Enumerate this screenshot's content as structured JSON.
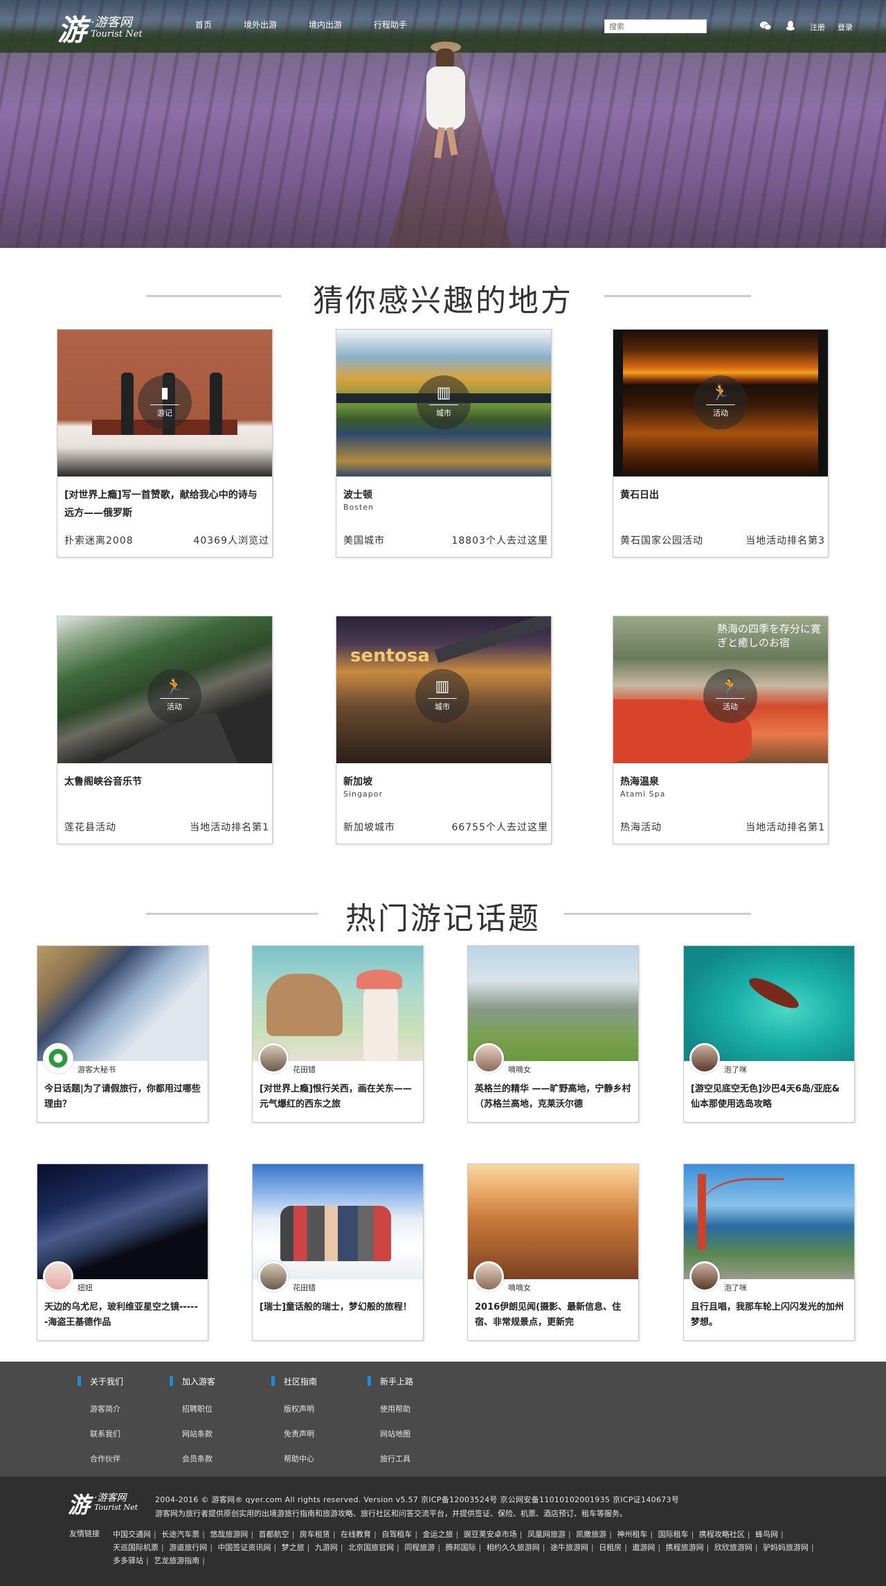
{
  "header": {
    "logo_mark": "游",
    "logo_cn": "·游客网",
    "logo_en": "Tourist Net",
    "nav": [
      "首页",
      "境外出游",
      "境内出游",
      "行程助手"
    ],
    "search_placeholder": "搜索",
    "register": "注册",
    "login": "登录"
  },
  "sections": {
    "places_title": "猜你感兴趣的地方",
    "topics_title": "热门游记话题"
  },
  "places": [
    {
      "badge": "游记",
      "badge_icon": "document-icon",
      "title": "[对世界上瘾]写一首赞歌，献给我心中的诗与远方——俄罗斯",
      "subtitle": "",
      "footer_left": "扑索迷离2008",
      "footer_right": "40369人浏览过"
    },
    {
      "badge": "城市",
      "badge_icon": "building-icon",
      "title": "波士顿",
      "subtitle": "Bosten",
      "footer_left": "美国城市",
      "footer_right": "18803个人去过这里"
    },
    {
      "badge": "活动",
      "badge_icon": "running-icon",
      "title": "黄石日出",
      "subtitle": "",
      "footer_left": "黄石国家公园活动",
      "footer_right": "当地活动排名第3"
    },
    {
      "badge": "活动",
      "badge_icon": "running-icon",
      "title": "太鲁阁峡谷音乐节",
      "subtitle": "",
      "footer_left": "莲花县活动",
      "footer_right": "当地活动排名第1"
    },
    {
      "badge": "城市",
      "badge_icon": "building-icon",
      "title": "新加坡",
      "subtitle": "Singapor",
      "footer_left": "新加坡城市",
      "footer_right": "66755个人去过这里"
    },
    {
      "badge": "活动",
      "badge_icon": "running-icon",
      "title": "热海温泉",
      "subtitle": "Atami Spa",
      "footer_left": "热海活动",
      "footer_right": "当地活动排名第1"
    }
  ],
  "place_image_text": {
    "sentosa": "sentosa",
    "onsen_jp": "熱海の四季を存分に寛ぎと癒しのお宿"
  },
  "topics": [
    {
      "author": "游客大秘书",
      "title": "今日话题|为了请假旅行，你都用过哪些理由？"
    },
    {
      "author": "花田错",
      "title": "[对世界上瘾]恨行关西，画在关东—— 元气爆红的西东之旅"
    },
    {
      "author": "嘀嘀女",
      "title": "英格兰的精华 ——旷野高地，宁静乡村（苏格兰高地，克莱沃尔德"
    },
    {
      "author": "泡了咪",
      "title": "[游空见底空无色]沙巴4天6岛/亚庇&仙本那使用选岛攻略"
    },
    {
      "author": "妞妞",
      "title": "天边的乌尤尼，玻利维亚星空之镜------海盗王基德作品"
    },
    {
      "author": "花田错",
      "title": "[瑞士]童话般的瑞士，梦幻般的旅程！"
    },
    {
      "author": "嘀嘀女",
      "title": "2016伊朗见闻(摄影、最新信息、住宿、非常规景点，更新完"
    },
    {
      "author": "泡了咪",
      "title": "且行且唱，我那车轮上闪闪发光的加州梦想。"
    }
  ],
  "footer": {
    "columns": [
      {
        "head": "关于我们",
        "links": [
          "游客简介",
          "联系我们",
          "合作伙伴"
        ]
      },
      {
        "head": "加入游客",
        "links": [
          "招聘职位",
          "网站条款",
          "会员条款"
        ]
      },
      {
        "head": "社区指南",
        "links": [
          "版权声明",
          "免责声明",
          "帮助中心"
        ]
      },
      {
        "head": "新手上路",
        "links": [
          "使用帮助",
          "网站地图",
          "旅行工具"
        ]
      }
    ],
    "logo_mark": "游",
    "logo_cn": "·游客网",
    "logo_en": "Tourist Net",
    "copyright": "2004-2016 © 游客网® qyer.com All rights reserved. Version v5.57 京ICP备12003524号 京公网安备11010102001935 京ICP证140673号",
    "description": "游客网为旅行者提供原创实用的出境游旅行指南和旅游攻略、旅行社区和问答交流平台，并提供签证、保险、机票、酒店预订、租车等服务。",
    "friend_label": "友情链接",
    "friend_links": [
      "中国交通网",
      "长途汽车票",
      "悠哉旅游网",
      "首都航空",
      "房车租赁",
      "在线教育",
      "自驾租车",
      "金运之旅",
      "豌豆荚安卓市场",
      "凤凰网旅游",
      "凯撒旅游",
      "神州租车",
      "国际租车",
      "携程攻略社区",
      "蜂鸟网",
      "天巡国际机票",
      "游道旅行网",
      "中国签证资讯网",
      "梦之旅",
      "九游网",
      "北京国旅官网",
      "同程旅游",
      "腾邦国际",
      "相约久久旅游网",
      "途牛旅游网",
      "日租房",
      "遨游网",
      "携程旅游网",
      "欣欣旅游网",
      "驴妈妈旅游网",
      "多多驿站",
      "艺龙旅游指南"
    ]
  },
  "colors": {
    "footer_top_bg": "#4a4a4a",
    "footer_bottom_bg": "#2f2f2f",
    "footer_accent": "#1a8ed8",
    "title_line": "#cccccc"
  }
}
